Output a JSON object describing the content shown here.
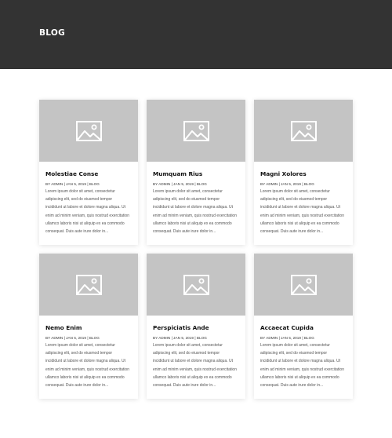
{
  "header": {
    "title": "BLOG"
  },
  "posts": [
    {
      "title": "Molestiae Conse",
      "meta": "BY ADMIN | JAN 5, 2019 | BLOG",
      "excerpt": [
        "Lorem ipsum dolor sit amet, consectetur",
        "adipiscing elit, sed do eiusmod tempor",
        "incididunt ut labore et dolore magna aliqua. Ut",
        "enim ad minim veniam, quis nostrud exercitation",
        "ullamco laboris nisi ut aliquip ex ea commodo",
        "consequat. Duis aute irure dolor in..."
      ]
    },
    {
      "title": "Mumquam Rius",
      "meta": "BY ADMIN | JAN 5, 2019 | BLOG",
      "excerpt": [
        "Lorem ipsum dolor sit amet, consectetur",
        "adipiscing elit, sed do eiusmod tempor",
        "incididunt ut labore et dolore magna aliqua. Ut",
        "enim ad minim veniam, quis nostrud exercitation",
        "ullamco laboris nisi ut aliquip ex ea commodo",
        "consequat. Duis aute irure dolor in..."
      ]
    },
    {
      "title": "Magni Xolores",
      "meta": "BY ADMIN | JAN 5, 2019 | BLOG",
      "excerpt": [
        "Lorem ipsum dolor sit amet, consectetur",
        "adipiscing elit, sed do eiusmod tempor",
        "incididunt ut labore et dolore magna aliqua. Ut",
        "enim ad minim veniam, quis nostrud exercitation",
        "ullamco laboris nisi ut aliquip ex ea commodo",
        "consequat. Duis aute irure dolor in..."
      ]
    },
    {
      "title": "Nemo Enim",
      "meta": "BY ADMIN | JAN 5, 2019 | BLOG",
      "excerpt": [
        "Lorem ipsum dolor sit amet, consectetur",
        "adipiscing elit, sed do eiusmod tempor",
        "incididunt ut labore et dolore magna aliqua. Ut",
        "enim ad minim veniam, quis nostrud exercitation",
        "ullamco laboris nisi ut aliquip ex ea commodo",
        "consequat. Duis aute irure dolor in..."
      ]
    },
    {
      "title": "Perspiciatis Ande",
      "meta": "BY ADMIN | JAN 5, 2019 | BLOG",
      "excerpt": [
        "Lorem ipsum dolor sit amet, consectetur",
        "adipiscing elit, sed do eiusmod tempor",
        "incididunt ut labore et dolore magna aliqua. Ut",
        "enim ad minim veniam, quis nostrud exercitation",
        "ullamco laboris nisi ut aliquip ex ea commodo",
        "consequat. Duis aute irure dolor in..."
      ]
    },
    {
      "title": "Accaecat Cupida",
      "meta": "BY ADMIN | JAN 5, 2019 | BLOG",
      "excerpt": [
        "Lorem ipsum dolor sit amet, consectetur",
        "adipiscing elit, sed do eiusmod tempor",
        "incididunt ut labore et dolore magna aliqua. Ut",
        "enim ad minim veniam, quis nostrud exercitation",
        "ullamco laboris nisi ut aliquip ex ea commodo",
        "consequat. Duis aute irure dolor in..."
      ]
    }
  ],
  "icons": {
    "thumbnail": "image-placeholder-icon"
  },
  "colors": {
    "header_bg": "#333333",
    "thumb_bg": "#c4c4c4"
  }
}
